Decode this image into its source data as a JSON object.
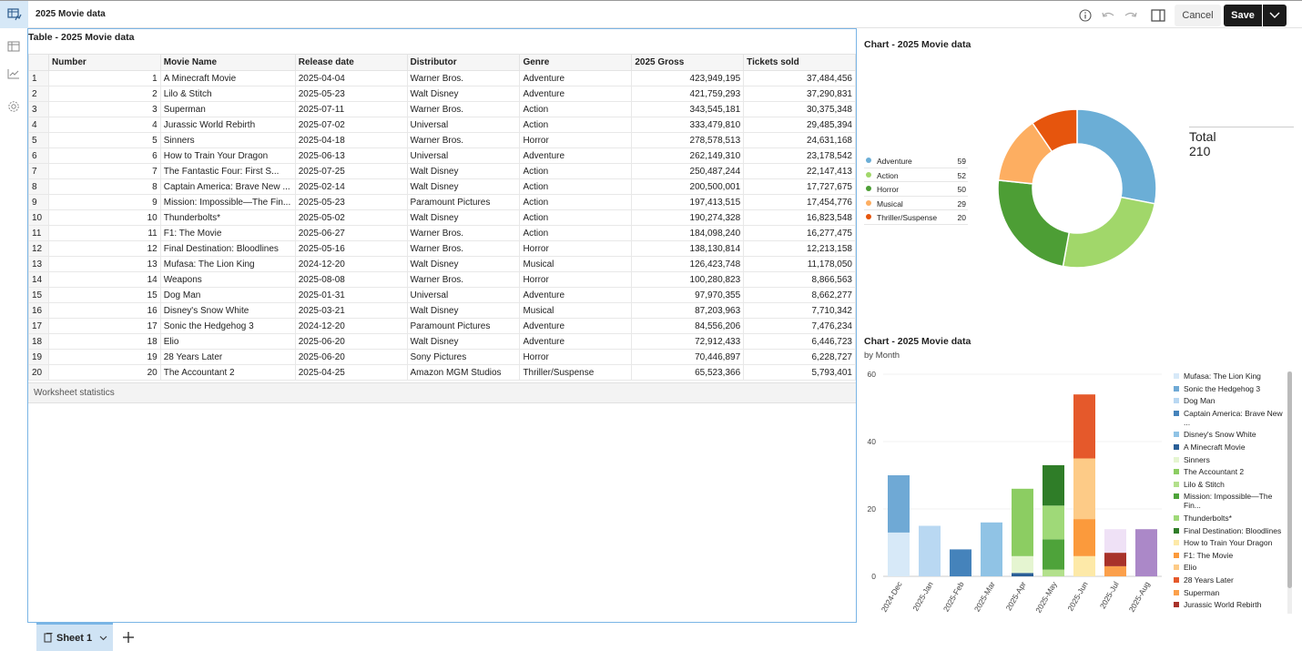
{
  "app": {
    "title": "2025 Movie data"
  },
  "toolbar": {
    "cancel_label": "Cancel",
    "save_label": "Save"
  },
  "table_panel": {
    "title": "Table - 2025 Movie data",
    "columns": [
      "Number",
      "Movie Name",
      "Release date",
      "Distributor",
      "Genre",
      "2025 Gross",
      "Tickets sold"
    ],
    "rows": [
      [
        "1",
        "1",
        "A Minecraft Movie",
        "2025-04-04",
        "Warner Bros.",
        "Adventure",
        "423,949,195",
        "37,484,456"
      ],
      [
        "2",
        "2",
        "Lilo & Stitch",
        "2025-05-23",
        "Walt Disney",
        "Adventure",
        "421,759,293",
        "37,290,831"
      ],
      [
        "3",
        "3",
        "Superman",
        "2025-07-11",
        "Warner Bros.",
        "Action",
        "343,545,181",
        "30,375,348"
      ],
      [
        "4",
        "4",
        "Jurassic World Rebirth",
        "2025-07-02",
        "Universal",
        "Action",
        "333,479,810",
        "29,485,394"
      ],
      [
        "5",
        "5",
        "Sinners",
        "2025-04-18",
        "Warner Bros.",
        "Horror",
        "278,578,513",
        "24,631,168"
      ],
      [
        "6",
        "6",
        "How to Train Your Dragon",
        "2025-06-13",
        "Universal",
        "Adventure",
        "262,149,310",
        "23,178,542"
      ],
      [
        "7",
        "7",
        "The Fantastic Four: First S...",
        "2025-07-25",
        "Walt Disney",
        "Action",
        "250,487,244",
        "22,147,413"
      ],
      [
        "8",
        "8",
        "Captain America: Brave New ...",
        "2025-02-14",
        "Walt Disney",
        "Action",
        "200,500,001",
        "17,727,675"
      ],
      [
        "9",
        "9",
        "Mission: Impossible—The Fin...",
        "2025-05-23",
        "Paramount Pictures",
        "Action",
        "197,413,515",
        "17,454,776"
      ],
      [
        "10",
        "10",
        "Thunderbolts*",
        "2025-05-02",
        "Walt Disney",
        "Action",
        "190,274,328",
        "16,823,548"
      ],
      [
        "11",
        "11",
        "F1: The Movie",
        "2025-06-27",
        "Warner Bros.",
        "Action",
        "184,098,240",
        "16,277,475"
      ],
      [
        "12",
        "12",
        "Final Destination: Bloodlines",
        "2025-05-16",
        "Warner Bros.",
        "Horror",
        "138,130,814",
        "12,213,158"
      ],
      [
        "13",
        "13",
        "Mufasa: The Lion King",
        "2024-12-20",
        "Walt Disney",
        "Musical",
        "126,423,748",
        "11,178,050"
      ],
      [
        "14",
        "14",
        "Weapons",
        "2025-08-08",
        "Warner Bros.",
        "Horror",
        "100,280,823",
        "8,866,563"
      ],
      [
        "15",
        "15",
        "Dog Man",
        "2025-01-31",
        "Universal",
        "Adventure",
        "97,970,355",
        "8,662,277"
      ],
      [
        "16",
        "16",
        "Disney's Snow White",
        "2025-03-21",
        "Walt Disney",
        "Musical",
        "87,203,963",
        "7,710,342"
      ],
      [
        "17",
        "17",
        "Sonic the Hedgehog 3",
        "2024-12-20",
        "Paramount Pictures",
        "Adventure",
        "84,556,206",
        "7,476,234"
      ],
      [
        "18",
        "18",
        "Elio",
        "2025-06-20",
        "Walt Disney",
        "Adventure",
        "72,912,433",
        "6,446,723"
      ],
      [
        "19",
        "19",
        "28 Years Later",
        "2025-06-20",
        "Sony Pictures",
        "Horror",
        "70,446,897",
        "6,228,727"
      ],
      [
        "20",
        "20",
        "The Accountant 2",
        "2025-04-25",
        "Amazon MGM Studios",
        "Thriller/Suspense",
        "65,523,366",
        "5,793,401"
      ]
    ],
    "worksheet_stats": "Worksheet statistics"
  },
  "chart_data": [
    {
      "type": "pie",
      "title": "Chart - 2025 Movie data",
      "categories": [
        "Adventure",
        "Action",
        "Horror",
        "Musical",
        "Thriller/Suspense"
      ],
      "values": [
        59,
        52,
        50,
        29,
        20
      ],
      "colors": [
        "#6baed6",
        "#a1d76a",
        "#4d9e35",
        "#fdae61",
        "#e6550d"
      ],
      "total_label": "Total",
      "total_value": "210",
      "legend": "left"
    },
    {
      "type": "bar",
      "stacked": true,
      "title": "Chart - 2025 Movie data",
      "subtitle": "by Month",
      "categories": [
        "2024-Dec",
        "2025-Jan",
        "2025-Feb",
        "2025-Mar",
        "2025-Apr",
        "2025-May",
        "2025-Jun",
        "2025-Jul",
        "2025-Aug"
      ],
      "ylim": [
        0,
        60
      ],
      "yticks": [
        0,
        20,
        40,
        60
      ],
      "legend": "right",
      "series": [
        {
          "name": "Mufasa: The Lion King",
          "color": "#d7e9f8",
          "values": [
            13,
            0,
            0,
            0,
            0,
            0,
            0,
            0,
            0
          ]
        },
        {
          "name": "Sonic the Hedgehog 3",
          "color": "#6fa9d5",
          "values": [
            17,
            0,
            0,
            0,
            0,
            0,
            0,
            0,
            0
          ]
        },
        {
          "name": "Dog Man",
          "color": "#b9d8f2",
          "values": [
            0,
            15,
            0,
            0,
            0,
            0,
            0,
            0,
            0
          ]
        },
        {
          "name": "Captain America: Brave New ...",
          "color": "#4583bb",
          "values": [
            0,
            0,
            8,
            0,
            0,
            0,
            0,
            0,
            0
          ]
        },
        {
          "name": "Disney's Snow White",
          "color": "#90c3e5",
          "values": [
            0,
            0,
            0,
            16,
            0,
            0,
            0,
            0,
            0
          ]
        },
        {
          "name": "A Minecraft Movie",
          "color": "#2a5f97",
          "values": [
            0,
            0,
            0,
            0,
            1,
            0,
            0,
            0,
            0
          ]
        },
        {
          "name": "Sinners",
          "color": "#e5f5d1",
          "values": [
            0,
            0,
            0,
            0,
            5,
            0,
            0,
            0,
            0
          ]
        },
        {
          "name": "The Accountant 2",
          "color": "#8ccd62",
          "values": [
            0,
            0,
            0,
            0,
            20,
            0,
            0,
            0,
            0
          ]
        },
        {
          "name": "Lilo & Stitch",
          "color": "#b3e08c",
          "values": [
            0,
            0,
            0,
            0,
            0,
            2,
            0,
            0,
            0
          ]
        },
        {
          "name": "Mission: Impossible—The Fin...",
          "color": "#4ea33a",
          "values": [
            0,
            0,
            0,
            0,
            0,
            9,
            0,
            0,
            0
          ]
        },
        {
          "name": "Thunderbolts*",
          "color": "#9fd978",
          "values": [
            0,
            0,
            0,
            0,
            0,
            10,
            0,
            0,
            0
          ]
        },
        {
          "name": "Final Destination: Bloodlines",
          "color": "#2f7d28",
          "values": [
            0,
            0,
            0,
            0,
            0,
            12,
            0,
            0,
            0
          ]
        },
        {
          "name": "How to Train Your Dragon",
          "color": "#fde9a8",
          "values": [
            0,
            0,
            0,
            0,
            0,
            0,
            6,
            0,
            0
          ]
        },
        {
          "name": "F1: The Movie",
          "color": "#fb9a3c",
          "values": [
            0,
            0,
            0,
            0,
            0,
            0,
            11,
            0,
            0
          ]
        },
        {
          "name": "Elio",
          "color": "#fdcb87",
          "values": [
            0,
            0,
            0,
            0,
            0,
            0,
            18,
            0,
            0
          ]
        },
        {
          "name": "28 Years Later",
          "color": "#e5592b",
          "values": [
            0,
            0,
            0,
            0,
            0,
            0,
            19,
            0,
            0
          ]
        },
        {
          "name": "Superman",
          "color": "#fba04b",
          "values": [
            0,
            0,
            0,
            0,
            0,
            0,
            0,
            3,
            0
          ]
        },
        {
          "name": "Jurassic World Rebirth",
          "color": "#a8322a",
          "values": [
            0,
            0,
            0,
            0,
            0,
            0,
            0,
            4,
            0
          ]
        },
        {
          "name": "",
          "color": "#efe1f6",
          "values": [
            0,
            0,
            0,
            0,
            0,
            0,
            0,
            7,
            0
          ]
        },
        {
          "name": "",
          "color": "#ab88c8",
          "values": [
            0,
            0,
            0,
            0,
            0,
            0,
            0,
            0,
            14
          ]
        }
      ]
    }
  ],
  "sheets": {
    "tab_label": "Sheet 1"
  },
  "icons": {
    "app": "table-chart-icon",
    "info": "info-icon",
    "undo": "undo-icon",
    "redo": "redo-icon",
    "panel": "side-panel-icon",
    "save_menu": "chevron-down-icon",
    "rail": [
      "table-icon",
      "line-chart-icon",
      "gear-icon"
    ],
    "add_sheet": "plus-icon"
  }
}
